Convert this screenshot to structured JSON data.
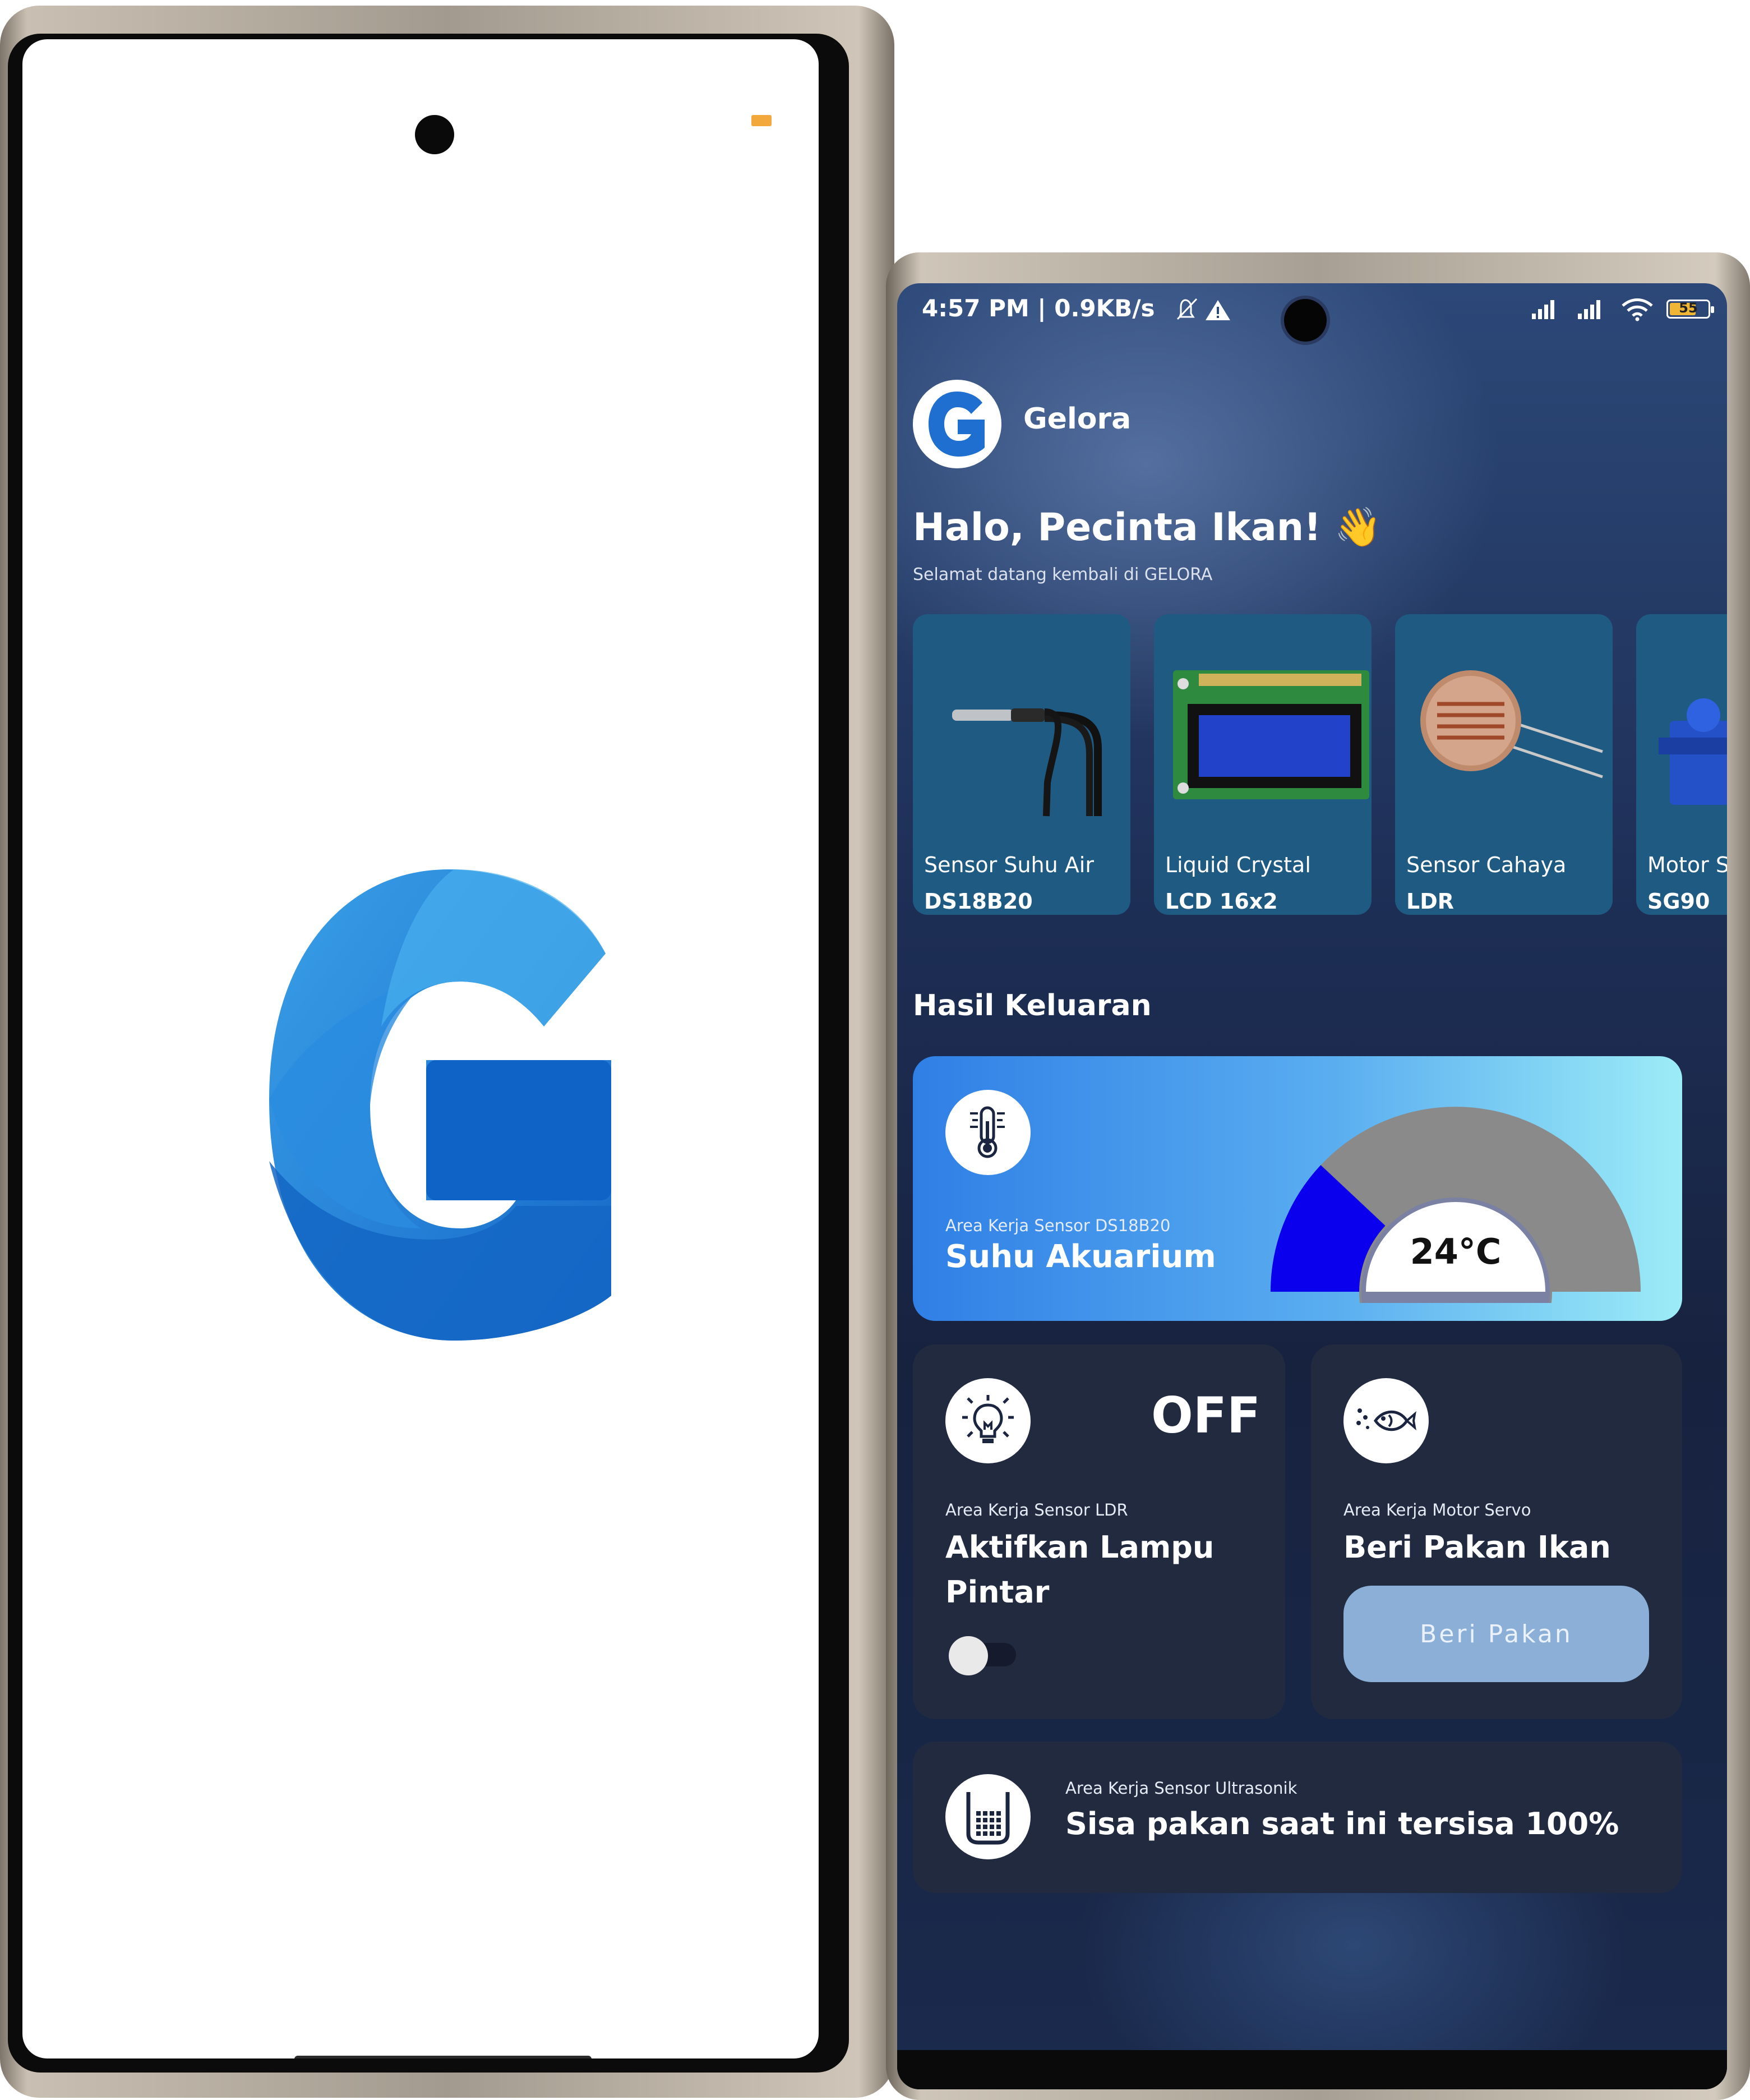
{
  "status_bar": {
    "time": "4:57 PM | 0.9KB/s",
    "battery": "55"
  },
  "app": {
    "name": "Gelora",
    "logo_letter": "G",
    "greeting": "Halo, Pecinta Ikan! 👋",
    "sub_greeting": "Selamat datang kembali di GELORA"
  },
  "sensors": [
    {
      "name": "Sensor Suhu Air",
      "model": "DS18B20"
    },
    {
      "name": "Liquid Crystal",
      "model": "LCD 16x2"
    },
    {
      "name": "Sensor Cahaya",
      "model": "LDR"
    },
    {
      "name": "Motor Servo",
      "model": "SG90"
    }
  ],
  "output_section": {
    "title": "Hasil Keluaran"
  },
  "temperature_card": {
    "area_label": "Area Kerja Sensor DS18B20",
    "title": "Suhu Akuarium",
    "value_label": "24°C",
    "gauge_fraction": 0.24
  },
  "lamp_card": {
    "area_label": "Area Kerja Sensor LDR",
    "title_line1": "Aktifkan Lampu",
    "title_line2": "Pintar",
    "state": "OFF",
    "toggle_on": false
  },
  "feed_card": {
    "area_label": "Area Kerja Motor Servo",
    "title": "Beri Pakan Ikan",
    "button_label": "Beri Pakan"
  },
  "ultrasonic_card": {
    "area_label": "Area Kerja Sensor Ultrasonik",
    "text": "Sisa pakan saat ini tersisa 100%"
  },
  "colors": {
    "brand_blue": "#1f6fd1",
    "card_teal": "#1f5a82",
    "card_dark": "#222a40",
    "button_blue": "#8bafd6",
    "gauge_fill": "#0a00ee",
    "gauge_track": "#8a8a8a"
  }
}
